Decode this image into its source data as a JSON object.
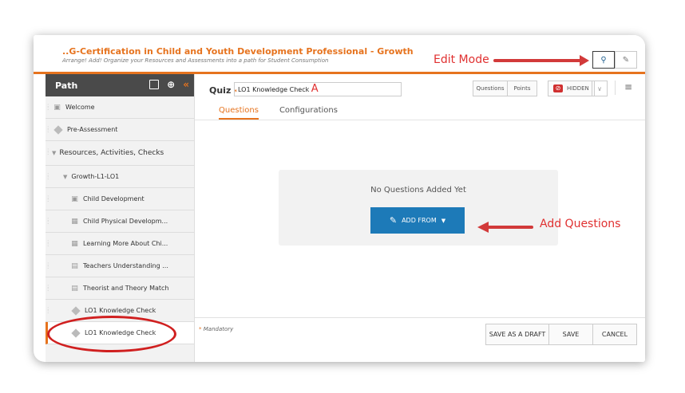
{
  "course": {
    "title": "..G-Certification in Child and Youth Development Professional - Growth",
    "subtitle": "Arrange! Add! Organize your Resources and Assessments into a path for Student Consumption"
  },
  "header_icons": [
    "search-icon",
    "pencil-icon"
  ],
  "annotations": {
    "edit_mode": "Edit Mode",
    "add_questions": "Add Questions",
    "quiz_marker": "A"
  },
  "sidebar": {
    "title": "Path",
    "items": [
      {
        "label": "Welcome",
        "icon": "page-icon"
      },
      {
        "label": "Pre-Assessment",
        "icon": "diamond-icon"
      },
      {
        "label": "Resources, Activities, Checks",
        "icon": "caret-icon"
      },
      {
        "label": "Growth-L1-LO1",
        "icon": "caret-icon"
      },
      {
        "label": "Child Development",
        "icon": "page-icon"
      },
      {
        "label": "Child Physical Developm...",
        "icon": "video-icon"
      },
      {
        "label": "Learning More About Chi...",
        "icon": "video-icon"
      },
      {
        "label": "Teachers Understanding ...",
        "icon": "doc-icon"
      },
      {
        "label": "Theorist and Theory Match",
        "icon": "doc-icon"
      },
      {
        "label": "LO1 Knowledge Check",
        "icon": "diamond-icon"
      },
      {
        "label": "LO1 Knowledge Check",
        "icon": "diamond-icon"
      }
    ]
  },
  "main": {
    "quiz_label": "Quiz",
    "required_mark": "*",
    "quiz_name": "LO1 Knowledge Check",
    "btn_questions": "Questions",
    "btn_points": "Points",
    "btn_hidden": "HIDDEN",
    "tabs": [
      "Questions",
      "Configurations"
    ],
    "empty_text": "No Questions Added Yet",
    "add_from": "ADD FROM",
    "mandatory": "Mandatory",
    "footer_buttons": [
      "SAVE AS A DRAFT",
      "SAVE",
      "CANCEL"
    ]
  },
  "colors": {
    "accent": "#e6731e",
    "primary_button": "#1d7ab8",
    "annotation": "#d23a3a"
  }
}
